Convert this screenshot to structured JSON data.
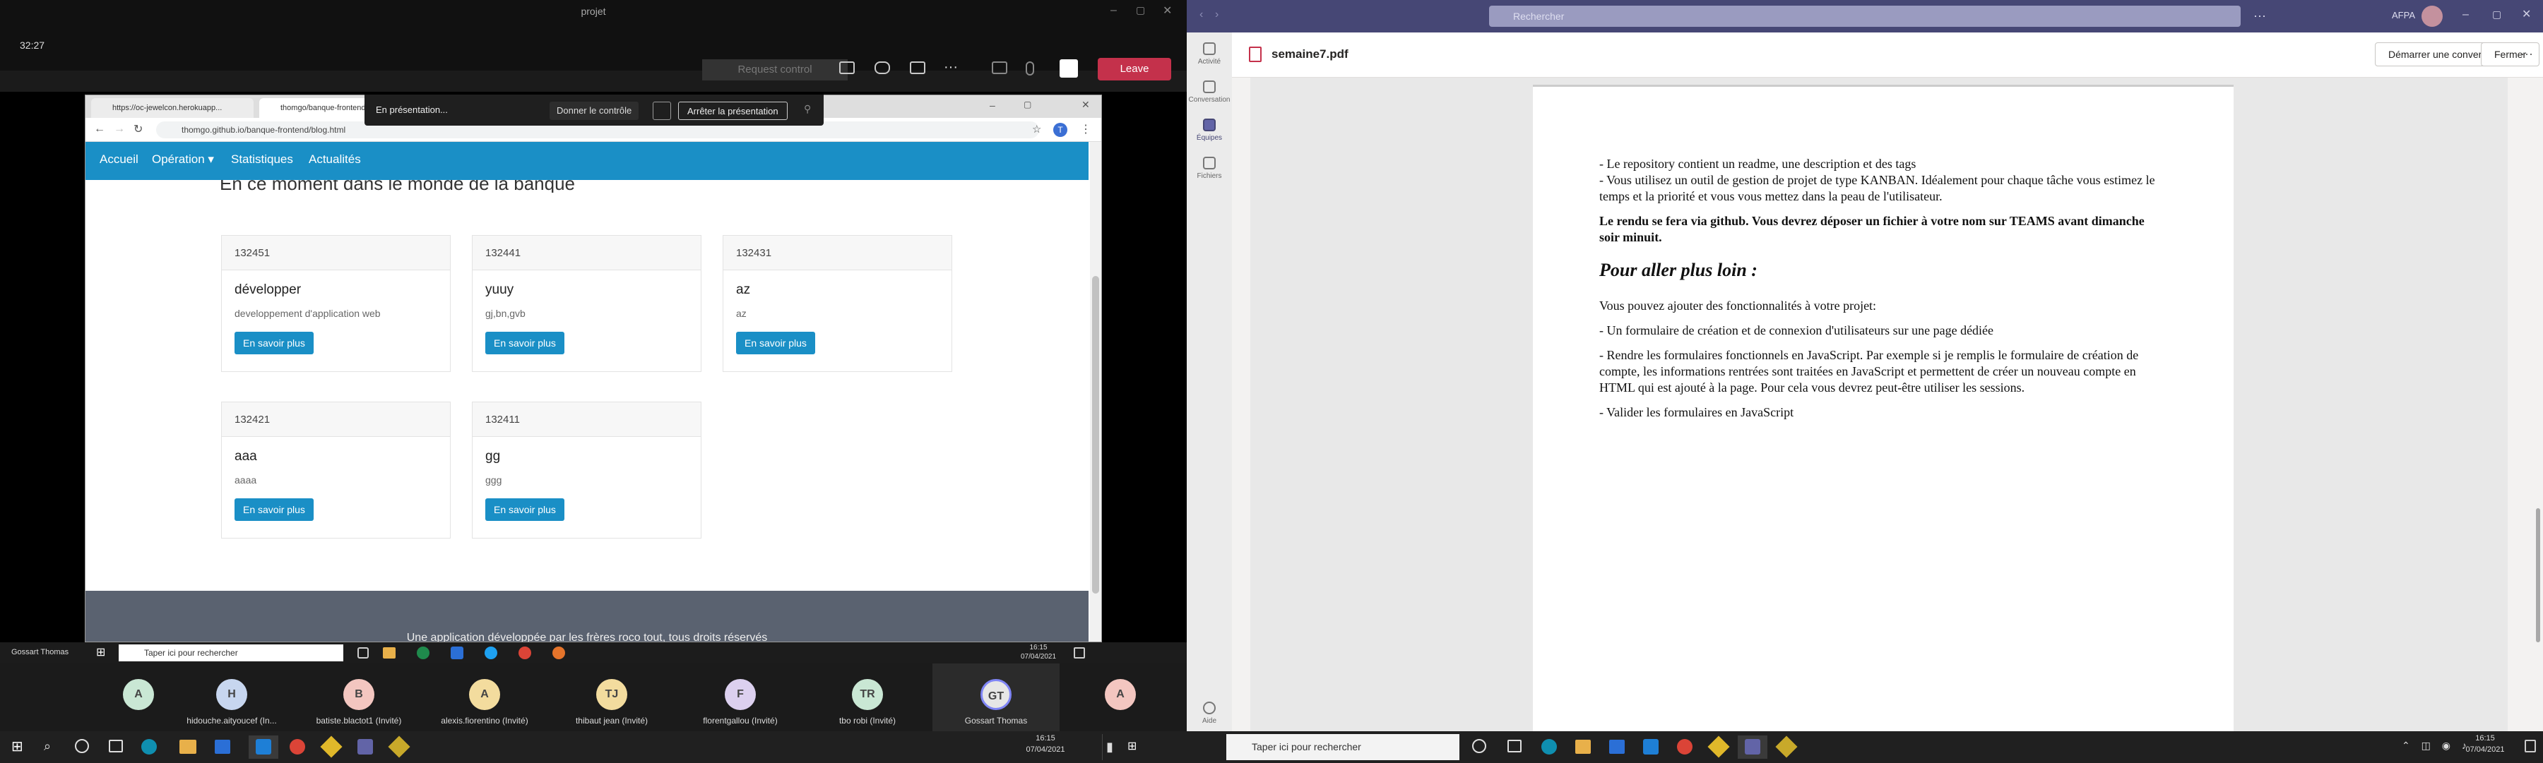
{
  "meeting": {
    "title": "projet",
    "timer": "32:27",
    "request_control": "Request control",
    "leave": "Leave",
    "presenter_name": "Gossart Thomas"
  },
  "share_bar": {
    "status": "En présentation...",
    "give_control": "Donner le contrôle",
    "stop": "Arrêter la présentation"
  },
  "browser": {
    "tabs": [
      "https://oc-jewelcon.herokuapp...",
      "thomgo/banque-frontend"
    ],
    "url": "thomgo.github.io/banque-frontend/blog.html",
    "avatar": "T"
  },
  "site": {
    "nav": [
      "Accueil",
      "Opération ▾",
      "Statistiques",
      "Actualités"
    ],
    "heading": "En ce moment dans le monde de la banque",
    "cards": [
      {
        "id": "132451",
        "title": "développer",
        "text": "developpement d'application web",
        "button": "En savoir plus"
      },
      {
        "id": "132441",
        "title": "yuuy",
        "text": "gj,bn,gvb",
        "button": "En savoir plus"
      },
      {
        "id": "132431",
        "title": "az",
        "text": "az",
        "button": "En savoir plus"
      },
      {
        "id": "132421",
        "title": "aaa",
        "text": "aaaa",
        "button": "En savoir plus"
      },
      {
        "id": "132411",
        "title": "gg",
        "text": "ggg",
        "button": "En savoir plus"
      }
    ],
    "footer": "Une application développée par les frères roco tout, tous droits réservés"
  },
  "inner_taskbar": {
    "search": "Taper ici pour rechercher",
    "time": "16:15",
    "date": "07/04/2021"
  },
  "participants": [
    {
      "initial": "A",
      "name": "",
      "color": "#c9e7d4"
    },
    {
      "initial": "H",
      "name": "hidouche.aityoucef (In...",
      "color": "#c7d6ef"
    },
    {
      "initial": "B",
      "name": "batiste.blactot1 (Invité)",
      "color": "#f3c6c0"
    },
    {
      "initial": "A",
      "name": "alexis.fiorentino (Invité)",
      "color": "#f3dc9e"
    },
    {
      "initial": "TJ",
      "name": "thibaut jean (Invité)",
      "color": "#f3dc9e"
    },
    {
      "initial": "F",
      "name": "florentgallou (Invité)",
      "color": "#dcd0ef"
    },
    {
      "initial": "TR",
      "name": "tbo robi (Invité)",
      "color": "#c9e7d4"
    },
    {
      "initial": "GT",
      "name": "Gossart Thomas",
      "color": "#e6e6e6"
    },
    {
      "initial": "A",
      "name": "",
      "color": "#f3c6c0"
    }
  ],
  "teams": {
    "search": "Rechercher",
    "org": "AFPA",
    "rail": [
      "Activité",
      "Conversation",
      "Équipes",
      "Fichiers",
      "Aide"
    ],
    "file": "semaine7.pdf",
    "start_conv": "Démarrer une conversation",
    "close": "Fermer"
  },
  "pdf": {
    "l1": "- Le repository contient un readme, une description et des tags",
    "l2": "- Vous utilisez un outil de gestion de projet de type KANBAN. Idéalement pour chaque tâche vous estimez le temps et la priorité et vous vous mettez dans la peau de l'utilisateur.",
    "bold": "Le rendu se fera via github. Vous devrez déposer un fichier à votre nom sur TEAMS avant dimanche soir minuit.",
    "h": "Pour aller plus loin :",
    "p1": "Vous pouvez ajouter des fonctionnalités à votre projet:",
    "p2": "- Un formulaire de création et de connexion d'utilisateurs sur une page dédiée",
    "p3": "- Rendre les formulaires fonctionnels en JavaScript. Par exemple si je remplis le formulaire de création de compte, les informations rentrées sont traitées en JavaScript et permettent de créer un nouveau compte en HTML qui est ajouté à la page. Pour cela vous devrez peut-être utiliser les sessions.",
    "p4": "- Valider les formulaires en JavaScript"
  },
  "taskbar": {
    "search": "Taper ici pour rechercher",
    "time": "16:15",
    "date": "07/04/2021"
  }
}
